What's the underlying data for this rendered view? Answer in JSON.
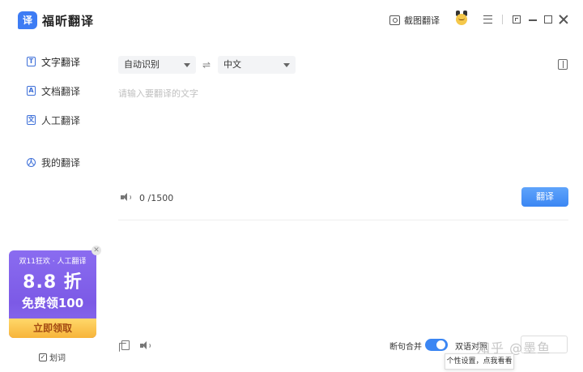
{
  "app": {
    "logo_glyph": "译",
    "title": "福昕翻译",
    "screenshot_label": "截图翻译"
  },
  "sidebar": {
    "items": [
      {
        "icon": "T",
        "label": "文字翻译"
      },
      {
        "icon": "A",
        "label": "文档翻译"
      },
      {
        "icon": "文",
        "label": "人工翻译"
      },
      {
        "icon": "人",
        "label": "我的翻译"
      }
    ],
    "promo": {
      "top": "双11狂欢 · 人工翻译",
      "big": "8.8 折",
      "mid": "免费领100",
      "cta": "立即领取",
      "close": "✕"
    },
    "huaci_label": "划词",
    "huaci_check": "✓"
  },
  "main": {
    "source_lang": "自动识别",
    "swap_glyph": "⇌",
    "target_lang": "中文",
    "placeholder": "请输入要翻译的文字",
    "char_count": "0 /1500",
    "translate_label": "翻译",
    "options": {
      "merge_label": "断句合并",
      "bilingual_label": "双语对照",
      "tooltip": "个性设置，点我看看"
    },
    "watermark": "知乎 @墨鱼"
  },
  "colors": {
    "accent": "#3b86f3",
    "promo_purple": "#7c5ae6",
    "promo_gold": "#f7b43a"
  }
}
